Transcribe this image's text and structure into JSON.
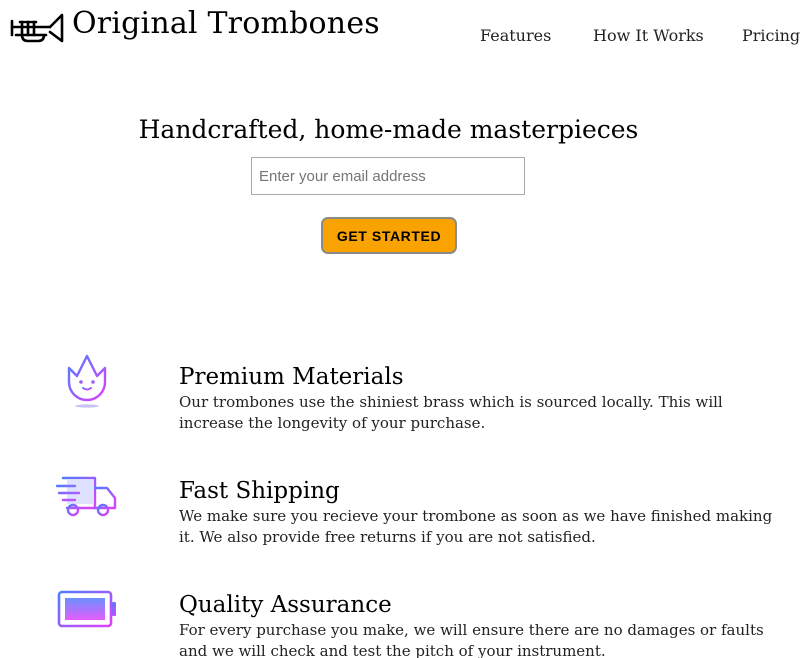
{
  "header": {
    "brand": "Original Trombones",
    "logo_icon": "trombone-icon",
    "nav": [
      {
        "label": "Features"
      },
      {
        "label": "How It Works"
      },
      {
        "label": "Pricing"
      }
    ]
  },
  "hero": {
    "title": "Handcrafted, home-made masterpieces",
    "email_placeholder": "Enter your email address",
    "cta_label": "GET STARTED"
  },
  "features": [
    {
      "icon": "fire-icon",
      "title": "Premium Materials",
      "description": "Our trombones use the shiniest brass which is sourced locally. This will increase the longevity of your purchase."
    },
    {
      "icon": "delivery-truck-icon",
      "title": "Fast Shipping",
      "description": "We make sure you recieve your trombone as soon as we have finished making it. We also provide free returns if you are not satisfied."
    },
    {
      "icon": "battery-icon",
      "title": "Quality Assurance",
      "description": "For every purchase you make, we will ensure there are no damages or faults and we will check and test the pitch of your instrument."
    }
  ],
  "colors": {
    "cta_background": "#f9a303",
    "icon_gradient_start": "#4f7dff",
    "icon_gradient_end": "#e040fb"
  }
}
